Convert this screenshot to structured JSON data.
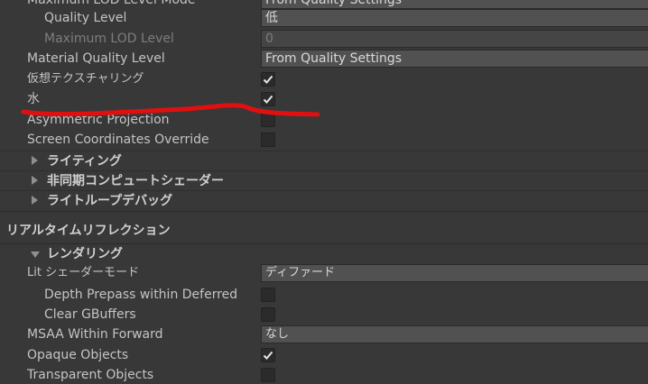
{
  "rows_top": {
    "max_lod_mode": {
      "label": "Maximum LOD Level Mode",
      "value": "From Quality Settings"
    },
    "quality_level": {
      "label": "Quality Level",
      "value": "低"
    },
    "max_lod_level": {
      "label": "Maximum LOD Level",
      "value": "0"
    },
    "material_quality": {
      "label": "Material Quality Level",
      "value": "From Quality Settings"
    },
    "virtual_texturing": {
      "label": "仮想テクスチャリング",
      "checked": true
    },
    "water": {
      "label": "水",
      "checked": true
    },
    "asymmetric_projection": {
      "label": "Asymmetric Projection",
      "checked": false
    },
    "screen_coord_override": {
      "label": "Screen Coordinates Override",
      "checked": false
    }
  },
  "foldouts": {
    "lighting": "ライティング",
    "async_compute": "非同期コンピュートシェーダー",
    "light_loop_debug": "ライトループデバッグ"
  },
  "realtime_reflection": {
    "section_title": "リアルタイムリフレクション",
    "rendering_foldout": "レンダリング",
    "lit_shader_mode": {
      "label": "Lit シェーダーモード",
      "value": "ディファード"
    },
    "depth_prepass": {
      "label": "Depth Prepass within Deferred",
      "checked": false
    },
    "clear_gbuffers": {
      "label": "Clear GBuffers",
      "checked": false
    },
    "msaa_forward": {
      "label": "MSAA Within Forward",
      "value": "なし"
    },
    "opaque_objects": {
      "label": "Opaque Objects",
      "checked": true
    },
    "transparent_objects": {
      "label": "Transparent Objects",
      "checked": false
    }
  },
  "annotation": {
    "color": "#e01010"
  }
}
